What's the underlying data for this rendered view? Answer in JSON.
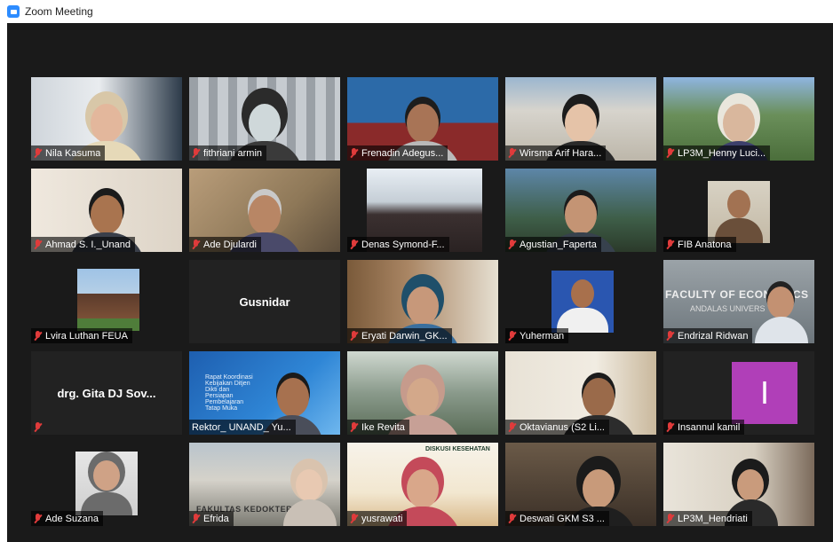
{
  "window": {
    "title": "Zoom Meeting",
    "app_icon": "zoom-camera-icon"
  },
  "colors": {
    "background": "#1a1a1a",
    "active_speaker": "#b6e84a",
    "muted_mic": "#e03b3b",
    "avatar_letter_bg": "#b03fb8"
  },
  "participants": [
    {
      "name": "Nila Kasuma",
      "muted": true
    },
    {
      "name": "fithriani armin",
      "muted": true
    },
    {
      "name": "Frenadin Adegus...",
      "muted": true
    },
    {
      "name": "Wirsma Arif Hara...",
      "muted": true
    },
    {
      "name": "LP3M_Henny Luci...",
      "muted": true,
      "active": true
    },
    {
      "name": "Ahmad S. I._Unand",
      "muted": true
    },
    {
      "name": "Ade Djulardi",
      "muted": true
    },
    {
      "name": "Denas Symond-F...",
      "muted": true
    },
    {
      "name": "Agustian_Faperta",
      "muted": true
    },
    {
      "name": "FIB Anatona",
      "muted": true
    },
    {
      "name": "Lvira Luthan FEUA",
      "muted": true
    },
    {
      "name": "Gusnidar",
      "muted": false,
      "video_off": true
    },
    {
      "name": "Eryati Darwin_GK...",
      "muted": true
    },
    {
      "name": "Yuherman",
      "muted": true
    },
    {
      "name": "Endrizal Ridwan",
      "muted": true,
      "banner": "FACULTY OF ECONOMICS",
      "banner_sub": "ANDALAS UNIVERS"
    },
    {
      "name": "drg. Gita DJ Sov...",
      "muted": true,
      "video_off": true
    },
    {
      "name": "Rektor_ UNAND_ Yu...",
      "muted": false,
      "slide": "Rapat Koordinasi Kebijakan Ditjen Dikti dan Persiapan Pembelajaran Tatap Muka"
    },
    {
      "name": "Ike Revita",
      "muted": true
    },
    {
      "name": "Oktavianus (S2 Li...",
      "muted": true
    },
    {
      "name": "Insannul kamil",
      "muted": true,
      "avatar_letter": "I"
    },
    {
      "name": "Ade Suzana",
      "muted": true
    },
    {
      "name": "Efrida",
      "muted": true,
      "banner": "FAKULTAS KEDOKTERA"
    },
    {
      "name": "yusrawati",
      "muted": true,
      "slide": "DISKUSI KESEHATAN"
    },
    {
      "name": "Deswati GKM S3 ...",
      "muted": true
    },
    {
      "name": "LP3M_Hendriati",
      "muted": true
    }
  ]
}
